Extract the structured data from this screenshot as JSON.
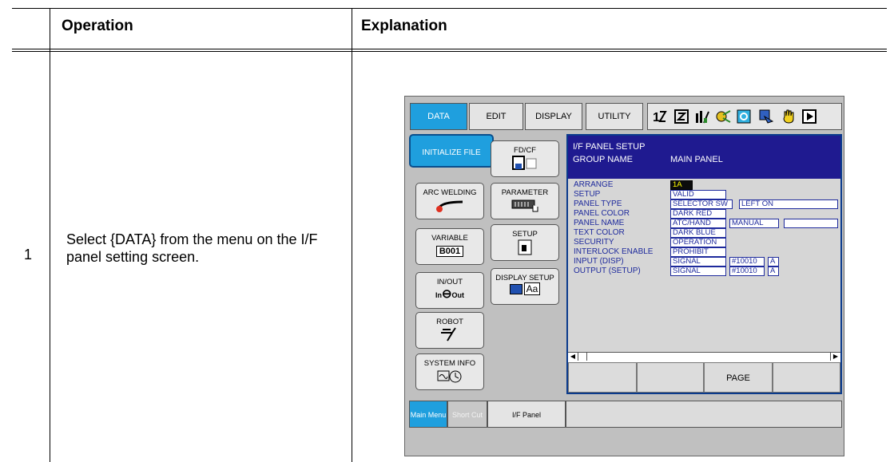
{
  "table": {
    "col1_header": "Operation",
    "col2_header": "Explanation",
    "step_number": "1",
    "step_text": "Select {DATA} from the menu on the I/F panel setting screen."
  },
  "screen": {
    "tabs": [
      "DATA",
      "EDIT",
      "DISPLAY",
      "UTILITY"
    ],
    "menu_left": [
      "INITIALIZE FILE",
      "ARC WELDING",
      "VARIABLE",
      "IN/OUT",
      "ROBOT",
      "SYSTEM INFO"
    ],
    "menu_right": [
      "FD/CF",
      "PARAMETER",
      "SETUP",
      "DISPLAY SETUP"
    ],
    "variable_value": "B001",
    "inout_in": "In",
    "inout_out": "Out",
    "aa_text": "Aa",
    "panel": {
      "title": "I/F PANEL SETUP",
      "group_label": "GROUP NAME",
      "group_value": "MAIN PANEL",
      "rows": [
        {
          "label": "ARRANGE",
          "value": "1A"
        },
        {
          "label": "SETUP",
          "value": "VALID"
        },
        {
          "label": "PANEL TYPE",
          "value": "SELECTOR SW",
          "extra": "LEFT ON"
        },
        {
          "label": "PANEL COLOR",
          "value": "DARK RED"
        },
        {
          "label": "PANEL NAME",
          "value": "ATC/HAND",
          "extra": "MANUAL"
        },
        {
          "label": "TEXT COLOR",
          "value": "DARK BLUE"
        },
        {
          "label": "SECURITY",
          "value": "OPERATION"
        },
        {
          "label": "INTERLOCK ENABLE",
          "value": "PROHIBIT"
        },
        {
          "label": "INPUT (DISP)",
          "value": "SIGNAL",
          "signal": "#10010",
          "suffix": "A"
        },
        {
          "label": "OUTPUT (SETUP)",
          "value": "SIGNAL",
          "signal": "#10010",
          "suffix": "A"
        }
      ],
      "fkeys": [
        "",
        "",
        "PAGE",
        ""
      ]
    },
    "bottom_tabs": [
      "Main Menu",
      "Short Cut",
      "I/F Panel"
    ]
  }
}
